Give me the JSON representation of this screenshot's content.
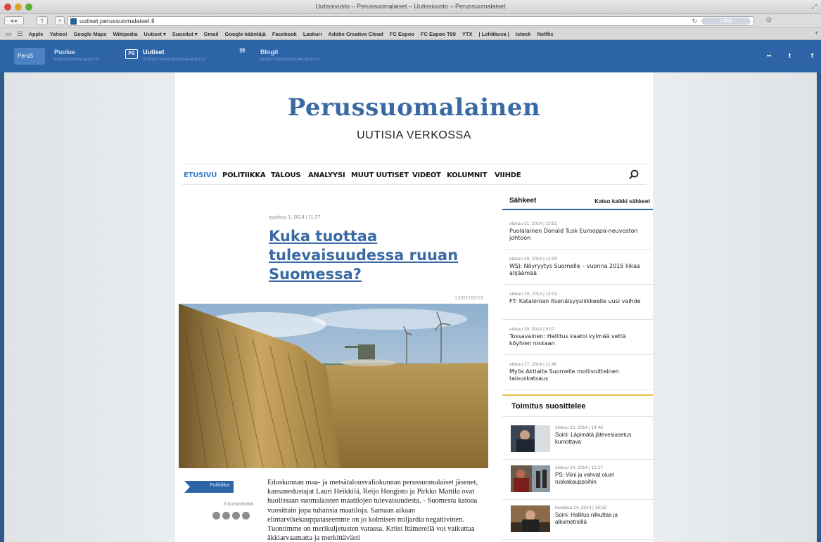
{
  "window": {
    "title": "Uutissivusto – Perussuomalaiset – Uutissivusto – Perussuomalaiset"
  },
  "addressbar": {
    "url": "uutiset.perussuomalaiset.fi",
    "reader_label": "Lukija"
  },
  "bookmarks": [
    "Apple",
    "Yahoo!",
    "Google Maps",
    "Wikipedia",
    "Uutiset ▾",
    "Suositut ▾",
    "Gmail",
    "Google-kääntäjä",
    "Facebook",
    "Laskuri",
    "Adobe Creative Cloud",
    "FC Espoo",
    "FC Espoo T99",
    "YTX",
    "| Lehtikuva |",
    "Istock",
    "Netflix"
  ],
  "sitebar": {
    "logo_text": "PeruS",
    "links": [
      {
        "label": "Puolue",
        "sub": "PERUSSUOMALAISET.FI"
      },
      {
        "label": "Uutiset",
        "sub": "UUTISET.PERUSSUOMALAISET.FI",
        "icon": "PS"
      },
      {
        "label": "Blogit",
        "sub": "BLOGIT.PERUSSUOMALAISET.FI",
        "icon": "❞"
      }
    ],
    "social": [
      "••",
      "t",
      "f"
    ]
  },
  "masthead": {
    "title": "Perussuomalainen",
    "tagline": "UUTISIA VERKOSSA"
  },
  "nav": [
    "ETUSIVU",
    "POLITIIKKA",
    "TALOUS",
    "ANALYYSI",
    "MUUT UUTISET",
    "VIDEOT",
    "KOLUMNIT",
    "VIIHDE"
  ],
  "article": {
    "meta": "syyskuu 1, 2014 | 11:27",
    "title": "Kuka tuottaa tulevaisuudessa ruuan Suomessa?",
    "photo_credit": "LEHTIKUVA",
    "category": "Politiikka",
    "comments": "6 kommenttia",
    "body": "Eduskunnan maa- ja metsätalousvaliokunnan perussuomalaiset jäsenet, kansanedustajat Lauri Heikkilä, Reijo Hongisto ja Pirkko Mattila ovat huolissaan suomalaisten maatilojen tulevaisuudesta. - Suomesta katoaa vuosittain jopa tuhansia maatiloja. Samaan aikaan elintarvikekauppataseemme on jo kolmisen miljardia negatiivinen. Tuontimme on merikuljetusten varassa. Kriisi Itämerellä voi vaikuttaa äkkiarvaamatta ja merkittävästi"
  },
  "sidebar": {
    "title": "Sähkeet",
    "all_link": "Katso kaikki sähkeet",
    "items": [
      {
        "meta": "elokuu 31, 2014 | 13:52",
        "text": "Puolalainen Donald Tusk Eurooppa-neuvoston johtoon"
      },
      {
        "meta": "elokuu 29, 2014 | 13:05",
        "text": "WSJ: Nöyryytys Suomelle – vuonna 2015 liikaa alijäämää"
      },
      {
        "meta": "elokuu 29, 2014 | 13:02",
        "text": "FT: Katalonian itsenäisyysliikkeelle uusi vaihde"
      },
      {
        "meta": "elokuu 29, 2014 | 9:07",
        "text": "Tossavainen: Hallitus kaatoi kylmää vettä köyhien niskaan"
      },
      {
        "meta": "elokuu 27, 2014 | 11:46",
        "text": "Myös Aktiaita Suomelle mollivoitteinen talouskatsaus"
      }
    ],
    "reco_title": "Toimitus suosittelee",
    "reco": [
      {
        "meta": "elokuu 23, 2014 | 14:46",
        "text": "Soini: Läpimätä jätevesiasetus kumottava"
      },
      {
        "meta": "elokuu 14, 2014 | 12:17",
        "text": "PS: Viini ja vahvat oluet ruokakauppoihin"
      },
      {
        "meta": "kesäkuu 24, 2014 | 16:56",
        "text": "Soini: Hallitus nilkuttaa ja alkumetreillä"
      }
    ]
  }
}
